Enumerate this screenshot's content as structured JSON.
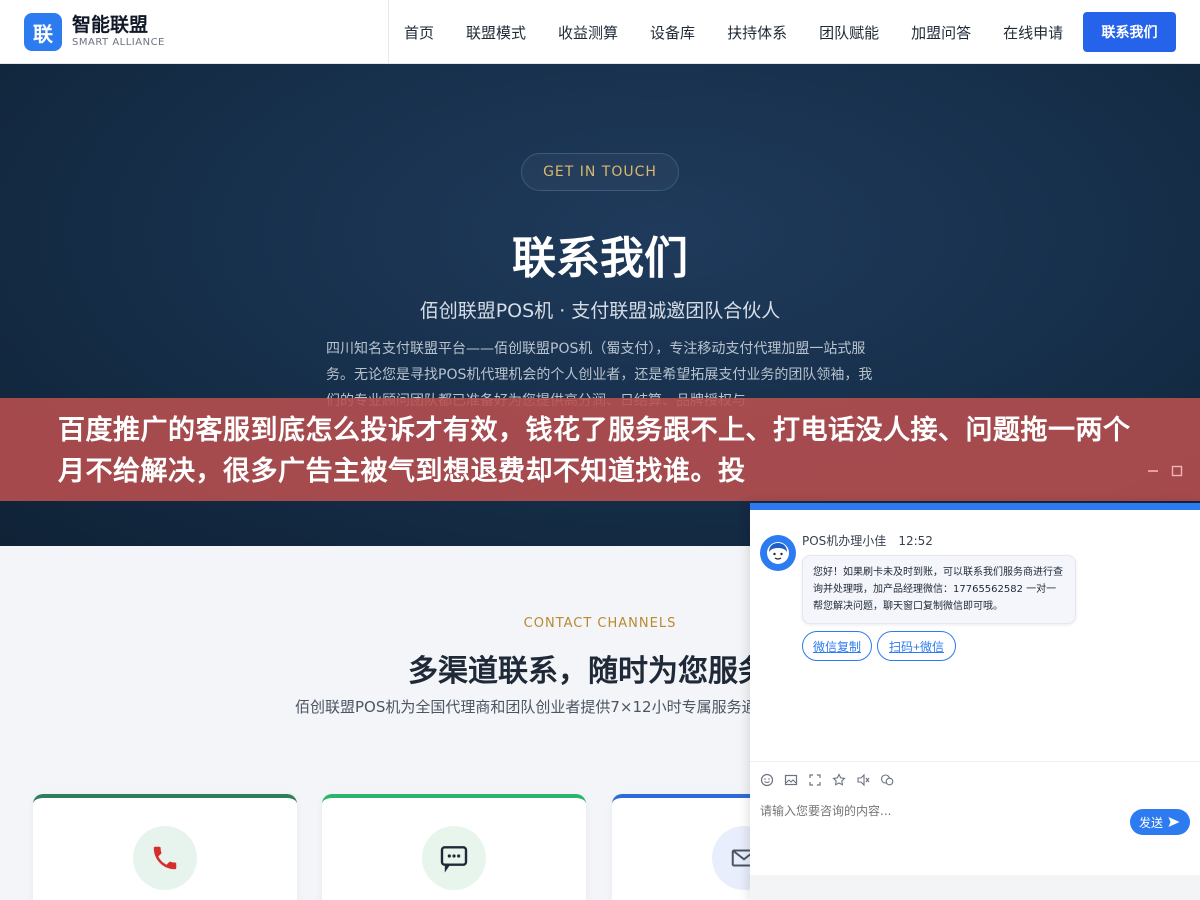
{
  "header": {
    "logo_mark": "联",
    "logo_title": "智能联盟",
    "logo_sub": "SMART ALLIANCE",
    "nav": [
      "首页",
      "联盟模式",
      "收益测算",
      "设备库",
      "扶持体系",
      "团队赋能",
      "加盟问答",
      "在线申请"
    ],
    "cta": "联系我们"
  },
  "hero": {
    "pill": "GET IN TOUCH",
    "title": "联系我们",
    "subtitle": "佰创联盟POS机 · 支付联盟诚邀团队合伙人",
    "desc": "四川知名支付联盟平台——佰创联盟POS机（蜀支付），专注移动支付代理加盟一站式服务。无论您是寻找POS机代理机会的个人创业者，还是希望拓展支付业务的团队领袖，我们的专业顾问团队都已准备好为您提供高分润、日结算、品牌授权与"
  },
  "banner": {
    "text": "百度推广的客服到底怎么投诉才有效，钱花了服务跟不上、打电话没人接、问题拖一两个月不给解决，很多广告主被气到想退费却不知道找谁。投"
  },
  "contact": {
    "eyebrow": "CONTACT CHANNELS",
    "title": "多渠道联系，随时为您服务",
    "desc": "佰创联盟POS机为全国代理商和团队创业者提供7×12小时专属服务通道，无论是电话沟通、微信交流还是邮件咨询，我们均确保快速响应、专业解答，让您无忧。"
  },
  "chat": {
    "sender": "POS机办理小佳",
    "time": "12:52",
    "message": "您好！如果刷卡未及时到账，可以联系我们服务商进行查询并处理哦，加产品经理微信：17765562582 一对一帮您解决问题，聊天窗口复制微信即可哦。",
    "quick_reply_1": "微信复制",
    "quick_reply_2": "扫码+微信",
    "input_placeholder": "请输入您要咨询的内容...",
    "send": "发送"
  },
  "colors": {
    "brand": "#2d7bf0",
    "hero_bg": "#17304c",
    "gold": "#d9b871",
    "banner": "#ba4e4e"
  }
}
